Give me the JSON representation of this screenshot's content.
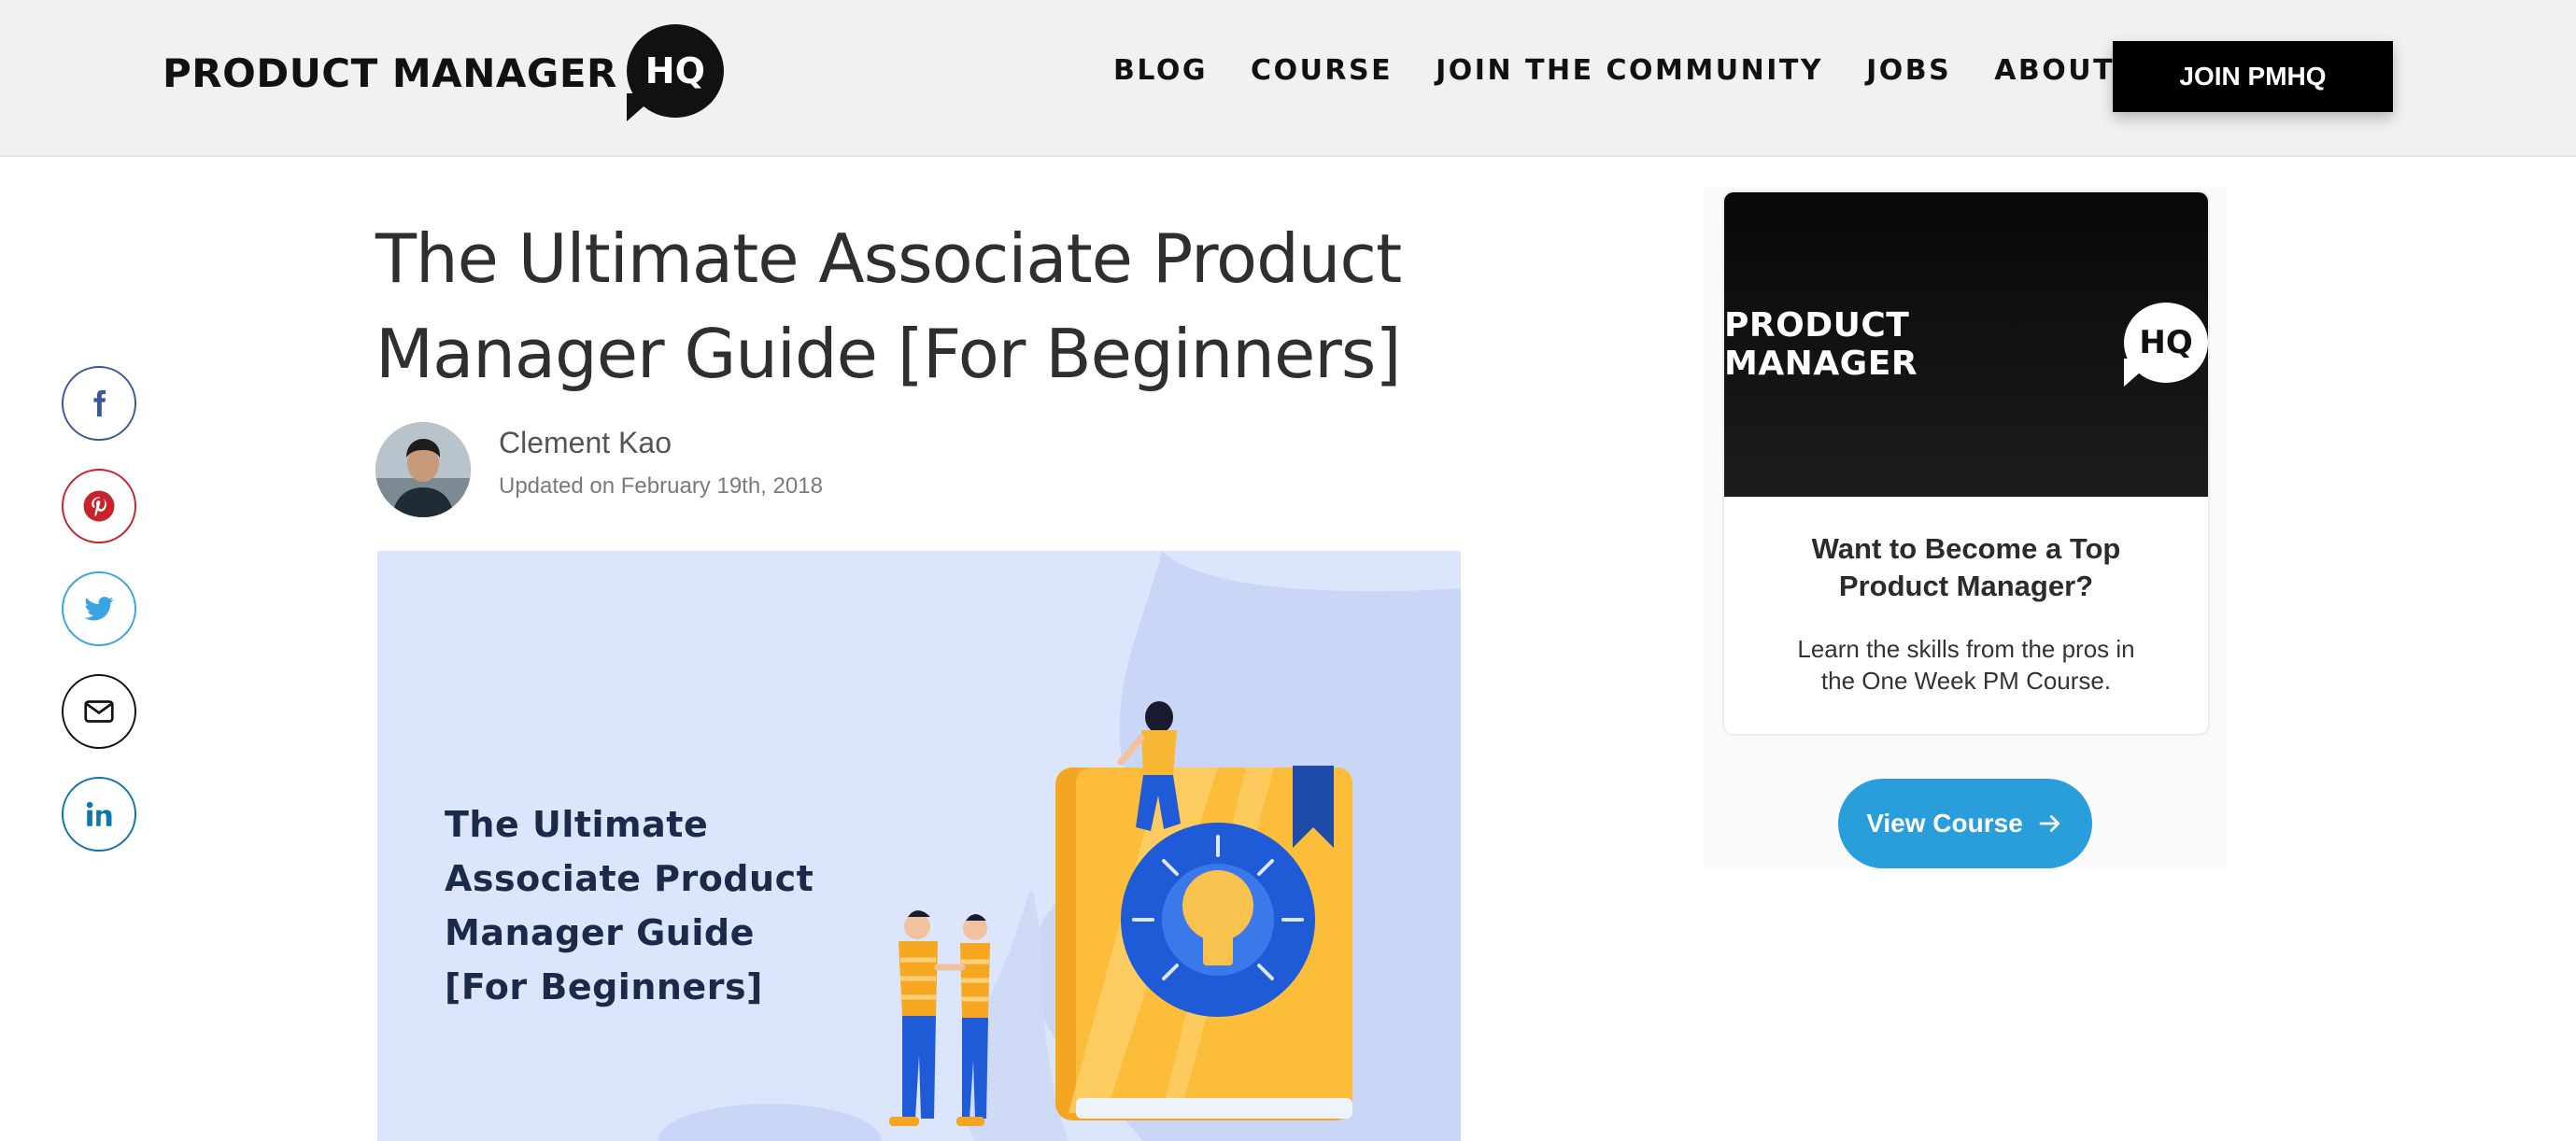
{
  "header": {
    "logo": {
      "text": "PRODUCT MANAGER",
      "badge": "HQ"
    },
    "nav": [
      {
        "label": "BLOG"
      },
      {
        "label": "COURSE"
      },
      {
        "label": "JOIN THE COMMUNITY"
      },
      {
        "label": "JOBS"
      },
      {
        "label": "ABOUT"
      }
    ],
    "cta_label": "JOIN PMHQ"
  },
  "share": [
    {
      "icon": "facebook-icon",
      "color": "#3b5998"
    },
    {
      "icon": "pinterest-icon",
      "color": "#c8232c"
    },
    {
      "icon": "twitter-icon",
      "color": "#3aa3e3"
    },
    {
      "icon": "email-icon",
      "color": "#111111"
    },
    {
      "icon": "linkedin-icon",
      "color": "#0e76a8"
    }
  ],
  "article": {
    "title": "The Ultimate Associate Product Manager Guide [For Beginners]",
    "author": "Clement Kao",
    "date": "Updated on February 19th, 2018",
    "hero_title": "The Ultimate Associate Product Manager Guide [For Beginners]"
  },
  "promo": {
    "logo": {
      "text": "PRODUCT MANAGER",
      "badge": "HQ"
    },
    "heading": "Want to Become a Top Product Manager?",
    "text": "Learn the skills from the pros in the One Week PM Course.",
    "button_label": "View Course",
    "button_color": "#2a9edb"
  }
}
